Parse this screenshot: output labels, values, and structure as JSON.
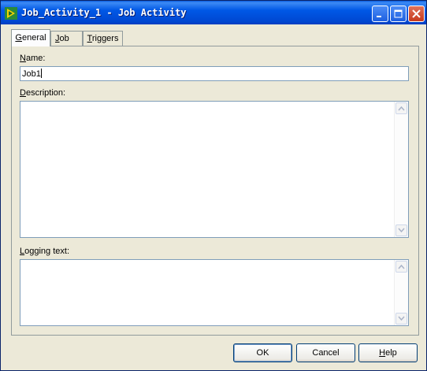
{
  "window": {
    "title": "Job_Activity_1 - Job Activity"
  },
  "tabs": [
    {
      "label_prefix": "",
      "accel": "G",
      "label_rest": "eneral",
      "selected": true
    },
    {
      "label_prefix": "",
      "accel": "J",
      "label_rest": "ob",
      "selected": false
    },
    {
      "label_prefix": "",
      "accel": "T",
      "label_rest": "riggers",
      "selected": false
    }
  ],
  "general": {
    "name_label": {
      "accel": "N",
      "rest": "ame:"
    },
    "name_value": "Job1",
    "description_label": {
      "accel": "D",
      "rest": "escription:"
    },
    "description_value": "",
    "logging_label": {
      "accel": "L",
      "rest": "ogging text:"
    },
    "logging_value": ""
  },
  "buttons": {
    "ok": "OK",
    "cancel": "Cancel",
    "help": {
      "accel": "H",
      "rest": "elp"
    }
  },
  "colors": {
    "title_bar": "#0054e3",
    "window_bg": "#ece9d8",
    "close_button": "#c7391c"
  }
}
